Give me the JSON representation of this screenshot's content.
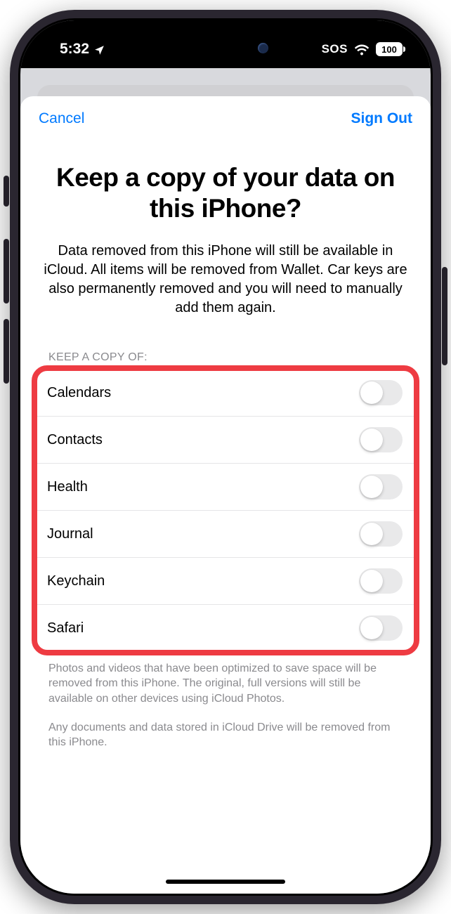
{
  "status": {
    "time": "5:32",
    "sos": "SOS",
    "battery": "100"
  },
  "nav": {
    "cancel": "Cancel",
    "signout": "Sign Out"
  },
  "title": "Keep a copy of your data on this iPhone?",
  "description": "Data removed from this iPhone will still be available in iCloud. All items will be removed from Wallet. Car keys are also permanently removed and you will need to manually add them again.",
  "list": {
    "header": "KEEP A COPY OF:",
    "items": [
      {
        "label": "Calendars",
        "on": false
      },
      {
        "label": "Contacts",
        "on": false
      },
      {
        "label": "Health",
        "on": false
      },
      {
        "label": "Journal",
        "on": false
      },
      {
        "label": "Keychain",
        "on": false
      },
      {
        "label": "Safari",
        "on": false
      }
    ]
  },
  "footer1": "Photos and videos that have been optimized to save space will be removed from this iPhone. The original, full versions will still be available on other devices using iCloud Photos.",
  "footer2": "Any documents and data stored in iCloud Drive will be removed from this iPhone."
}
